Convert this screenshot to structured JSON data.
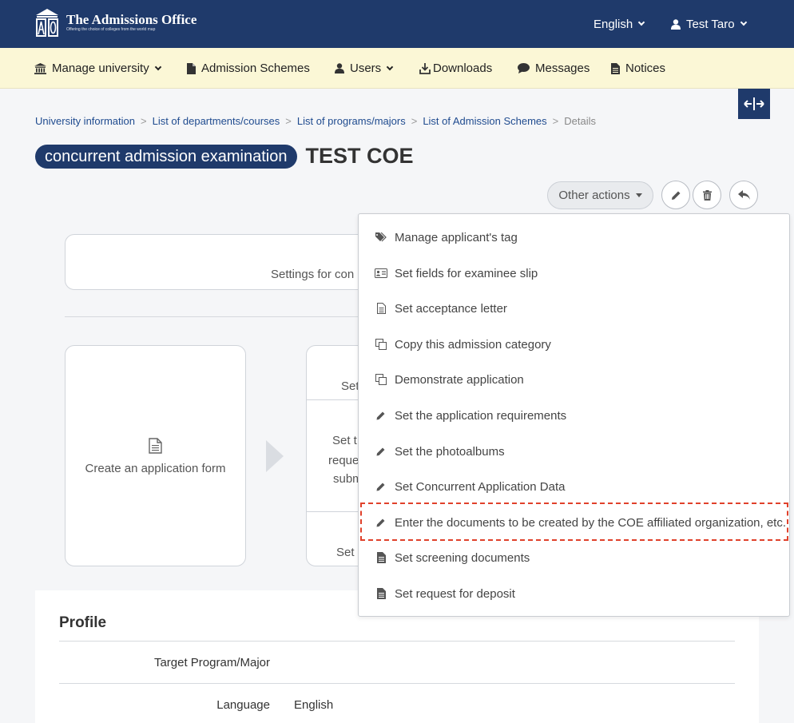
{
  "header": {
    "logo_title": "The Admissions Office",
    "logo_subtitle": "Offering the choice of colleges from the world map",
    "language": "English",
    "user": "Test Taro",
    "bg_color": "#1f3a6b"
  },
  "nav": {
    "items": [
      {
        "label": "Manage university",
        "icon": "bank-icon"
      },
      {
        "label": "Admission Schemes",
        "icon": "file-icon"
      },
      {
        "label": "Users",
        "icon": "user-icon"
      },
      {
        "label": "Downloads",
        "icon": "download-icon"
      },
      {
        "label": "Messages",
        "icon": "chat-icon"
      },
      {
        "label": "Notices",
        "icon": "file-icon"
      }
    ],
    "bg_color": "#fbf7d6"
  },
  "breadcrumb": [
    "University information",
    "List of departments/courses",
    "List of programs/majors",
    "List of Admission Schemes",
    "Details"
  ],
  "page": {
    "badge": "concurrent admission examination",
    "title": "TEST COE",
    "other_actions": "Other actions"
  },
  "flow": {
    "settings_text": "Settings for con",
    "step1": "Create an application form",
    "step2_top": "Set",
    "step2_mid": [
      "Set t",
      "reque",
      "subm"
    ],
    "step2_bottom": "Set"
  },
  "profile": {
    "title": "Profile",
    "rows": [
      {
        "label": "Target Program/Major",
        "value": ""
      },
      {
        "label": "Language",
        "value": "English"
      }
    ]
  },
  "dropdown": {
    "items": [
      {
        "label": "Manage applicant's tag",
        "icon": "tags-icon"
      },
      {
        "label": "Set fields for examinee slip",
        "icon": "id-card-icon"
      },
      {
        "label": "Set acceptance letter",
        "icon": "document-outline-icon"
      },
      {
        "label": "Copy this admission category",
        "icon": "copy-icon"
      },
      {
        "label": "Demonstrate application",
        "icon": "copy-icon"
      },
      {
        "label": "Set the application requirements",
        "icon": "pencil-icon"
      },
      {
        "label": "Set the photoalbums",
        "icon": "pencil-icon"
      },
      {
        "label": "Set Concurrent Application Data",
        "icon": "pencil-icon"
      },
      {
        "label": "Enter the documents to be created by the COE affiliated organization, etc.",
        "icon": "pencil-icon"
      },
      {
        "label": "Set screening documents",
        "icon": "document-icon"
      },
      {
        "label": "Set request for deposit",
        "icon": "document-icon"
      }
    ],
    "highlighted_index": 8,
    "highlight_color": "#e0412b"
  }
}
